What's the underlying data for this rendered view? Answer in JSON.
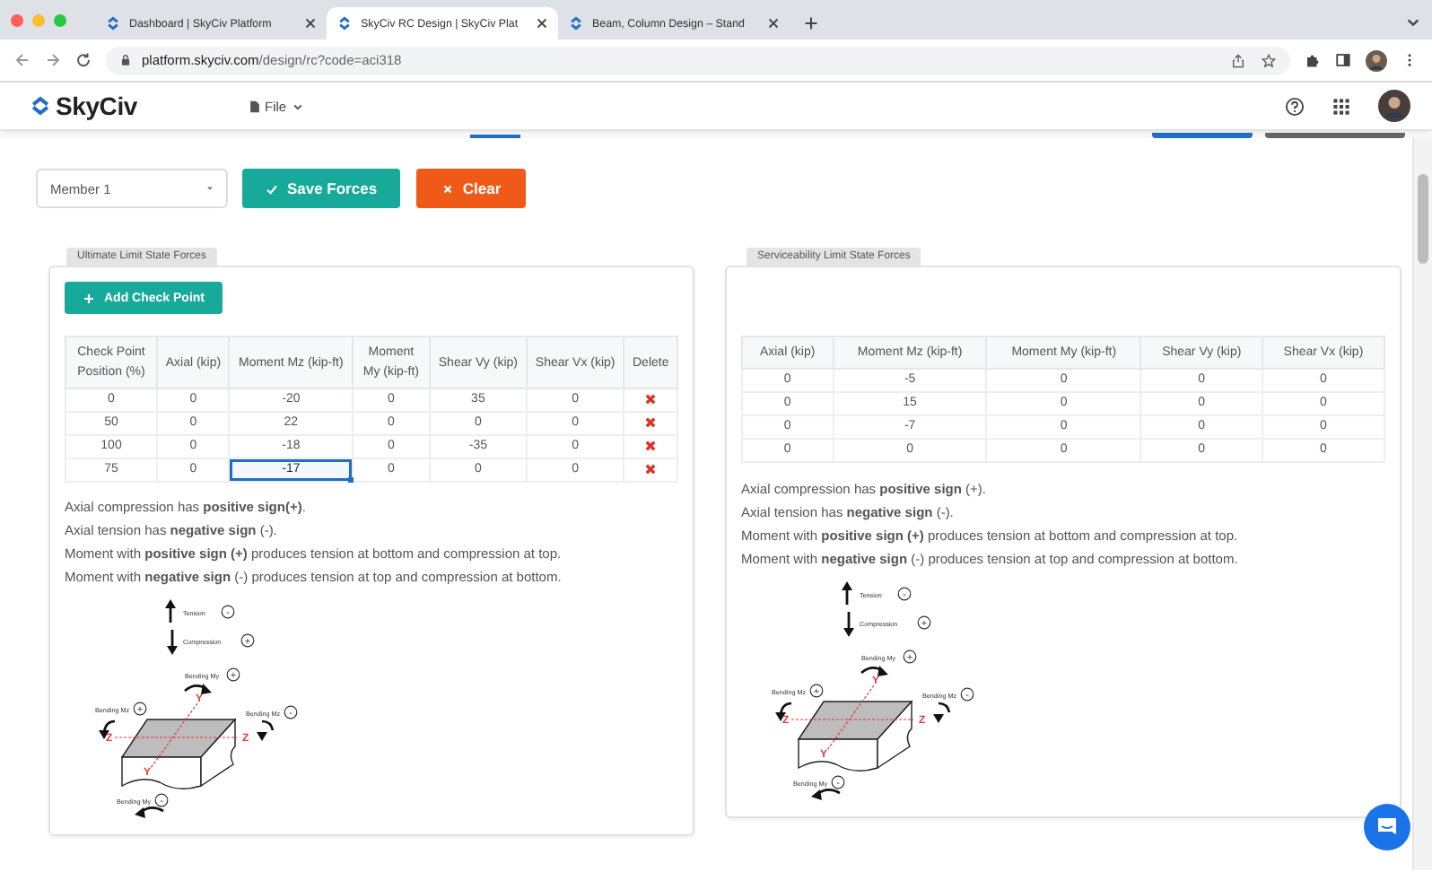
{
  "browser": {
    "tabs": [
      {
        "title": "Dashboard | SkyCiv Platform",
        "selected": false
      },
      {
        "title": "SkyCiv RC Design | SkyCiv Plat",
        "selected": true
      },
      {
        "title": "Beam, Column Design – Stand",
        "selected": false
      }
    ],
    "url_host": "platform.skyciv.com",
    "url_path": "/design/rc?code=aci318"
  },
  "app_header": {
    "logo": "SkyCiv",
    "menu": "File"
  },
  "toolbar": {
    "member": "Member 1",
    "save": "Save Forces",
    "clear": "Clear"
  },
  "panels": [
    {
      "tab": "Ultimate Limit State Forces",
      "add_button": "Add Check Point",
      "columns": [
        {
          "label": "Check Point Position (%)",
          "kind": "value"
        },
        {
          "label": "Axial (kip)",
          "kind": "value"
        },
        {
          "label": "Moment Mz (kip-ft)",
          "kind": "value"
        },
        {
          "label": "Moment My (kip-ft)",
          "kind": "value"
        },
        {
          "label": "Shear Vy (kip)",
          "kind": "value"
        },
        {
          "label": "Shear Vx (kip)",
          "kind": "value"
        },
        {
          "label": "Delete",
          "kind": "delete"
        }
      ],
      "rows": [
        [
          {
            "v": "0",
            "focused": false
          },
          {
            "v": "0",
            "focused": false
          },
          {
            "v": "-20",
            "focused": false
          },
          {
            "v": "0",
            "focused": false
          },
          {
            "v": "35",
            "focused": false
          },
          {
            "v": "0",
            "focused": false
          }
        ],
        [
          {
            "v": "50",
            "focused": false
          },
          {
            "v": "0",
            "focused": false
          },
          {
            "v": "22",
            "focused": false
          },
          {
            "v": "0",
            "focused": false
          },
          {
            "v": "0",
            "focused": false
          },
          {
            "v": "0",
            "focused": false
          }
        ],
        [
          {
            "v": "100",
            "focused": false
          },
          {
            "v": "0",
            "focused": false
          },
          {
            "v": "-18",
            "focused": false
          },
          {
            "v": "0",
            "focused": false
          },
          {
            "v": "-35",
            "focused": false
          },
          {
            "v": "0",
            "focused": false
          }
        ],
        [
          {
            "v": "75",
            "focused": false
          },
          {
            "v": "0",
            "focused": false
          },
          {
            "v": "-17",
            "focused": true
          },
          {
            "v": "0",
            "focused": false
          },
          {
            "v": "0",
            "focused": false
          },
          {
            "v": "0",
            "focused": false
          }
        ]
      ],
      "notes": [
        "Axial compression has **positive sign(+)**.",
        "Axial tension has **negative sign** (-).",
        "Moment with **positive sign (+)** produces tension at bottom and compression at top.",
        "Moment with **negative sign** (-) produces tension at top and compression at bottom."
      ],
      "diagram": {
        "tension": {
          "label": "Tension",
          "sign": "-"
        },
        "compression": {
          "label": "Compression",
          "sign": "+"
        },
        "my_top": {
          "label": "Bending My",
          "sign": "+"
        },
        "mz_left": {
          "label": "Bending Mz",
          "sign": "+"
        },
        "mz_right": {
          "label": "Bending Mz",
          "sign": "-"
        },
        "my_bottom": {
          "label": "Bending My",
          "sign": "-"
        },
        "y_top": "Y",
        "z_left": "Z",
        "z_right": "Z",
        "y_bottom": "Y"
      }
    },
    {
      "tab": "Serviceability Limit State Forces",
      "columns": [
        {
          "label": "Axial (kip)",
          "kind": "value"
        },
        {
          "label": "Moment Mz (kip-ft)",
          "kind": "value"
        },
        {
          "label": "Moment My (kip-ft)",
          "kind": "value"
        },
        {
          "label": "Shear Vy (kip)",
          "kind": "value"
        },
        {
          "label": "Shear Vx (kip)",
          "kind": "value"
        }
      ],
      "rows": [
        [
          {
            "v": "0",
            "focused": false
          },
          {
            "v": "-5",
            "focused": false
          },
          {
            "v": "0",
            "focused": false
          },
          {
            "v": "0",
            "focused": false
          },
          {
            "v": "0",
            "focused": false
          }
        ],
        [
          {
            "v": "0",
            "focused": false
          },
          {
            "v": "15",
            "focused": false
          },
          {
            "v": "0",
            "focused": false
          },
          {
            "v": "0",
            "focused": false
          },
          {
            "v": "0",
            "focused": false
          }
        ],
        [
          {
            "v": "0",
            "focused": false
          },
          {
            "v": "-7",
            "focused": false
          },
          {
            "v": "0",
            "focused": false
          },
          {
            "v": "0",
            "focused": false
          },
          {
            "v": "0",
            "focused": false
          }
        ],
        [
          {
            "v": "0",
            "focused": false
          },
          {
            "v": "0",
            "focused": false
          },
          {
            "v": "0",
            "focused": false
          },
          {
            "v": "0",
            "focused": false
          },
          {
            "v": "0",
            "focused": false
          }
        ]
      ],
      "notes": [
        "Axial compression has **positive sign** (+).",
        "Axial tension has **negative sign** (-).",
        "Moment with **positive sign (+)** produces tension at bottom and compression at top.",
        "Moment with **negative sign** (-) produces tension at top and compression at bottom."
      ],
      "diagram": {
        "tension": {
          "label": "Tension",
          "sign": "-"
        },
        "compression": {
          "label": "Compression",
          "sign": "+"
        },
        "my_top": {
          "label": "Bending My",
          "sign": "+"
        },
        "mz_left": {
          "label": "Bending Mz",
          "sign": "+"
        },
        "mz_right": {
          "label": "Bending Mz",
          "sign": "-"
        },
        "my_bottom": {
          "label": "Bending My",
          "sign": "-"
        },
        "y_top": "Y",
        "z_left": "Z",
        "z_right": "Z",
        "y_bottom": "Y"
      }
    }
  ]
}
